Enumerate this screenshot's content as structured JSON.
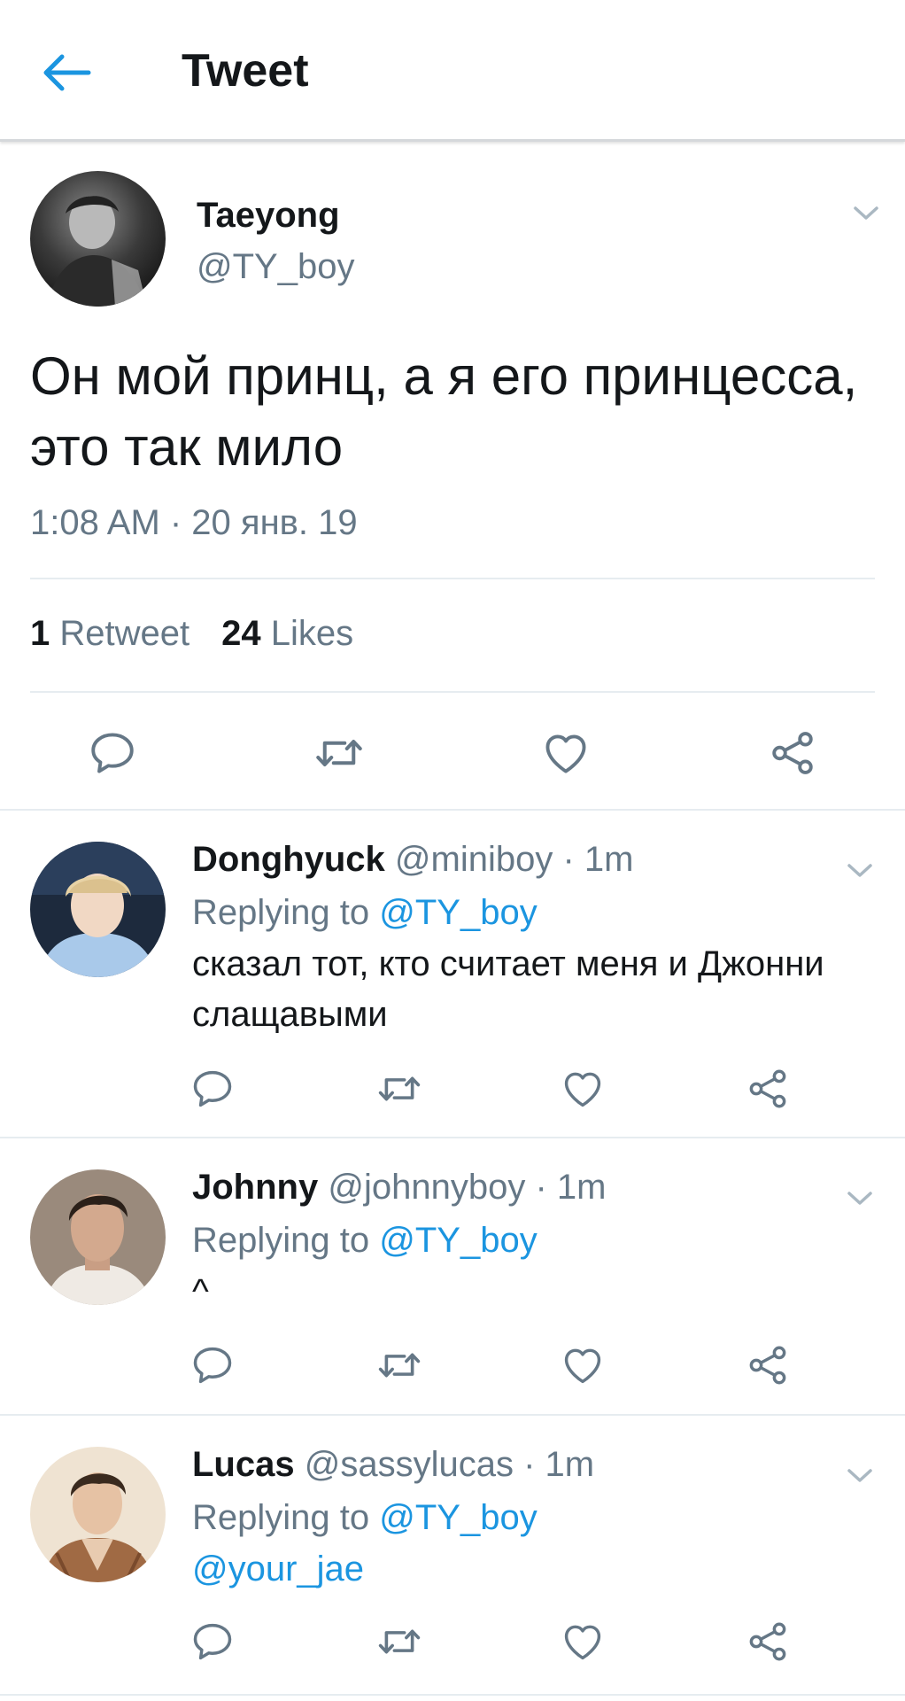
{
  "header": {
    "title": "Tweet"
  },
  "main_tweet": {
    "name": "Taeyong",
    "handle": "@TY_boy",
    "text": "Он мой принц, а я его принцесса, это так мило",
    "time": "1:08 AM · 20 янв. 19",
    "retweets_count": "1",
    "retweets_label": "Retweet",
    "likes_count": "24",
    "likes_label": "Likes"
  },
  "replies": [
    {
      "name": "Donghyuck",
      "meta": "@miniboy · 1m",
      "replying_prefix": "Replying to",
      "replying_to": "@TY_boy",
      "text": "сказал тот, кто считает меня и Джонни слащавыми"
    },
    {
      "name": "Johnny",
      "meta": "@johnnyboy · 1m",
      "replying_prefix": "Replying to",
      "replying_to": "@TY_boy",
      "text": "^"
    },
    {
      "name": "Lucas",
      "meta": "@sassylucas · 1m",
      "replying_prefix": "Replying to",
      "replying_to": "@TY_boy",
      "text": "@your_jae"
    }
  ],
  "icons": {
    "back": "arrow-left-icon",
    "more": "chevron-down-icon",
    "reply": "speech-bubble-icon",
    "retweet": "retweet-icon",
    "like": "heart-icon",
    "share": "share-icon"
  },
  "colors": {
    "accent": "#1b95e0",
    "text": "#14171a",
    "secondary": "#657786",
    "divider": "#e6ecf0"
  }
}
